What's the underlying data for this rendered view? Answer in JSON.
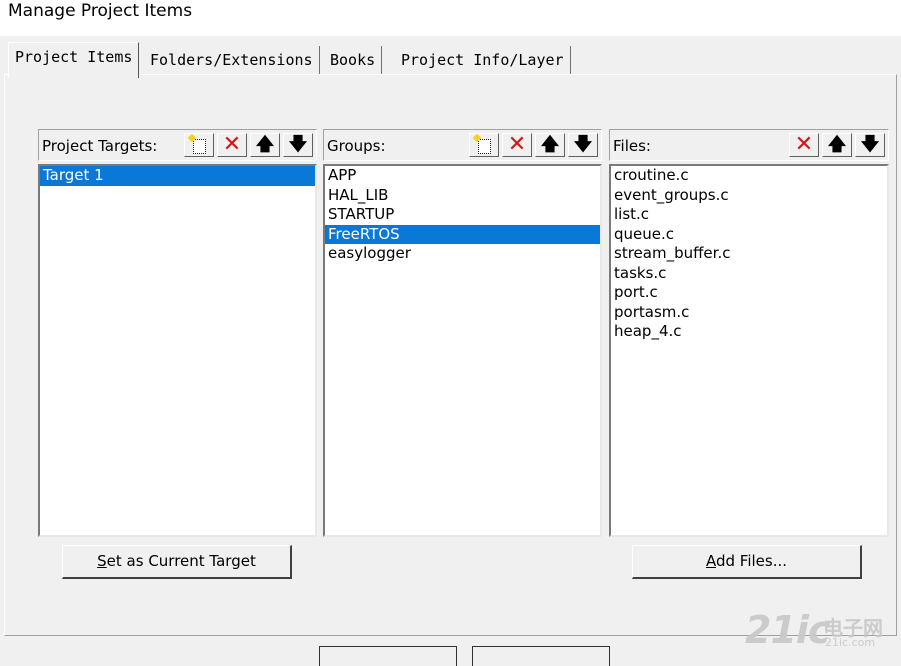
{
  "window": {
    "title": "Manage Project Items"
  },
  "tabs": [
    {
      "label": "Project Items",
      "active": true
    },
    {
      "label": "Folders/Extensions",
      "active": false
    },
    {
      "label": "Books",
      "active": false
    },
    {
      "label": "Project Info/Layer",
      "active": false
    }
  ],
  "targets": {
    "header": "Project Targets:",
    "items": [
      "Target 1"
    ],
    "selected_index": 0
  },
  "groups": {
    "header": "Groups:",
    "items": [
      "APP",
      "HAL_LIB",
      "STARTUP",
      "FreeRTOS",
      "easylogger"
    ],
    "selected_index": 3
  },
  "files": {
    "header": "Files:",
    "items": [
      "croutine.c",
      "event_groups.c",
      "list.c",
      "queue.c",
      "stream_buffer.c",
      "tasks.c",
      "port.c",
      "portasm.c",
      "heap_4.c"
    ]
  },
  "toolbar_icons": {
    "new": "new-item-icon",
    "delete": "delete-icon",
    "up": "arrow-up-icon",
    "down": "arrow-down-icon",
    "delete_color": "#d01818",
    "selection_color": "#0a78d7"
  },
  "buttons": {
    "set_current_target": "Set as Current Target",
    "add_files": "Add Files..."
  },
  "watermark": {
    "main": "21ic",
    "cn": "电子网",
    "domain": "21ic.com"
  }
}
